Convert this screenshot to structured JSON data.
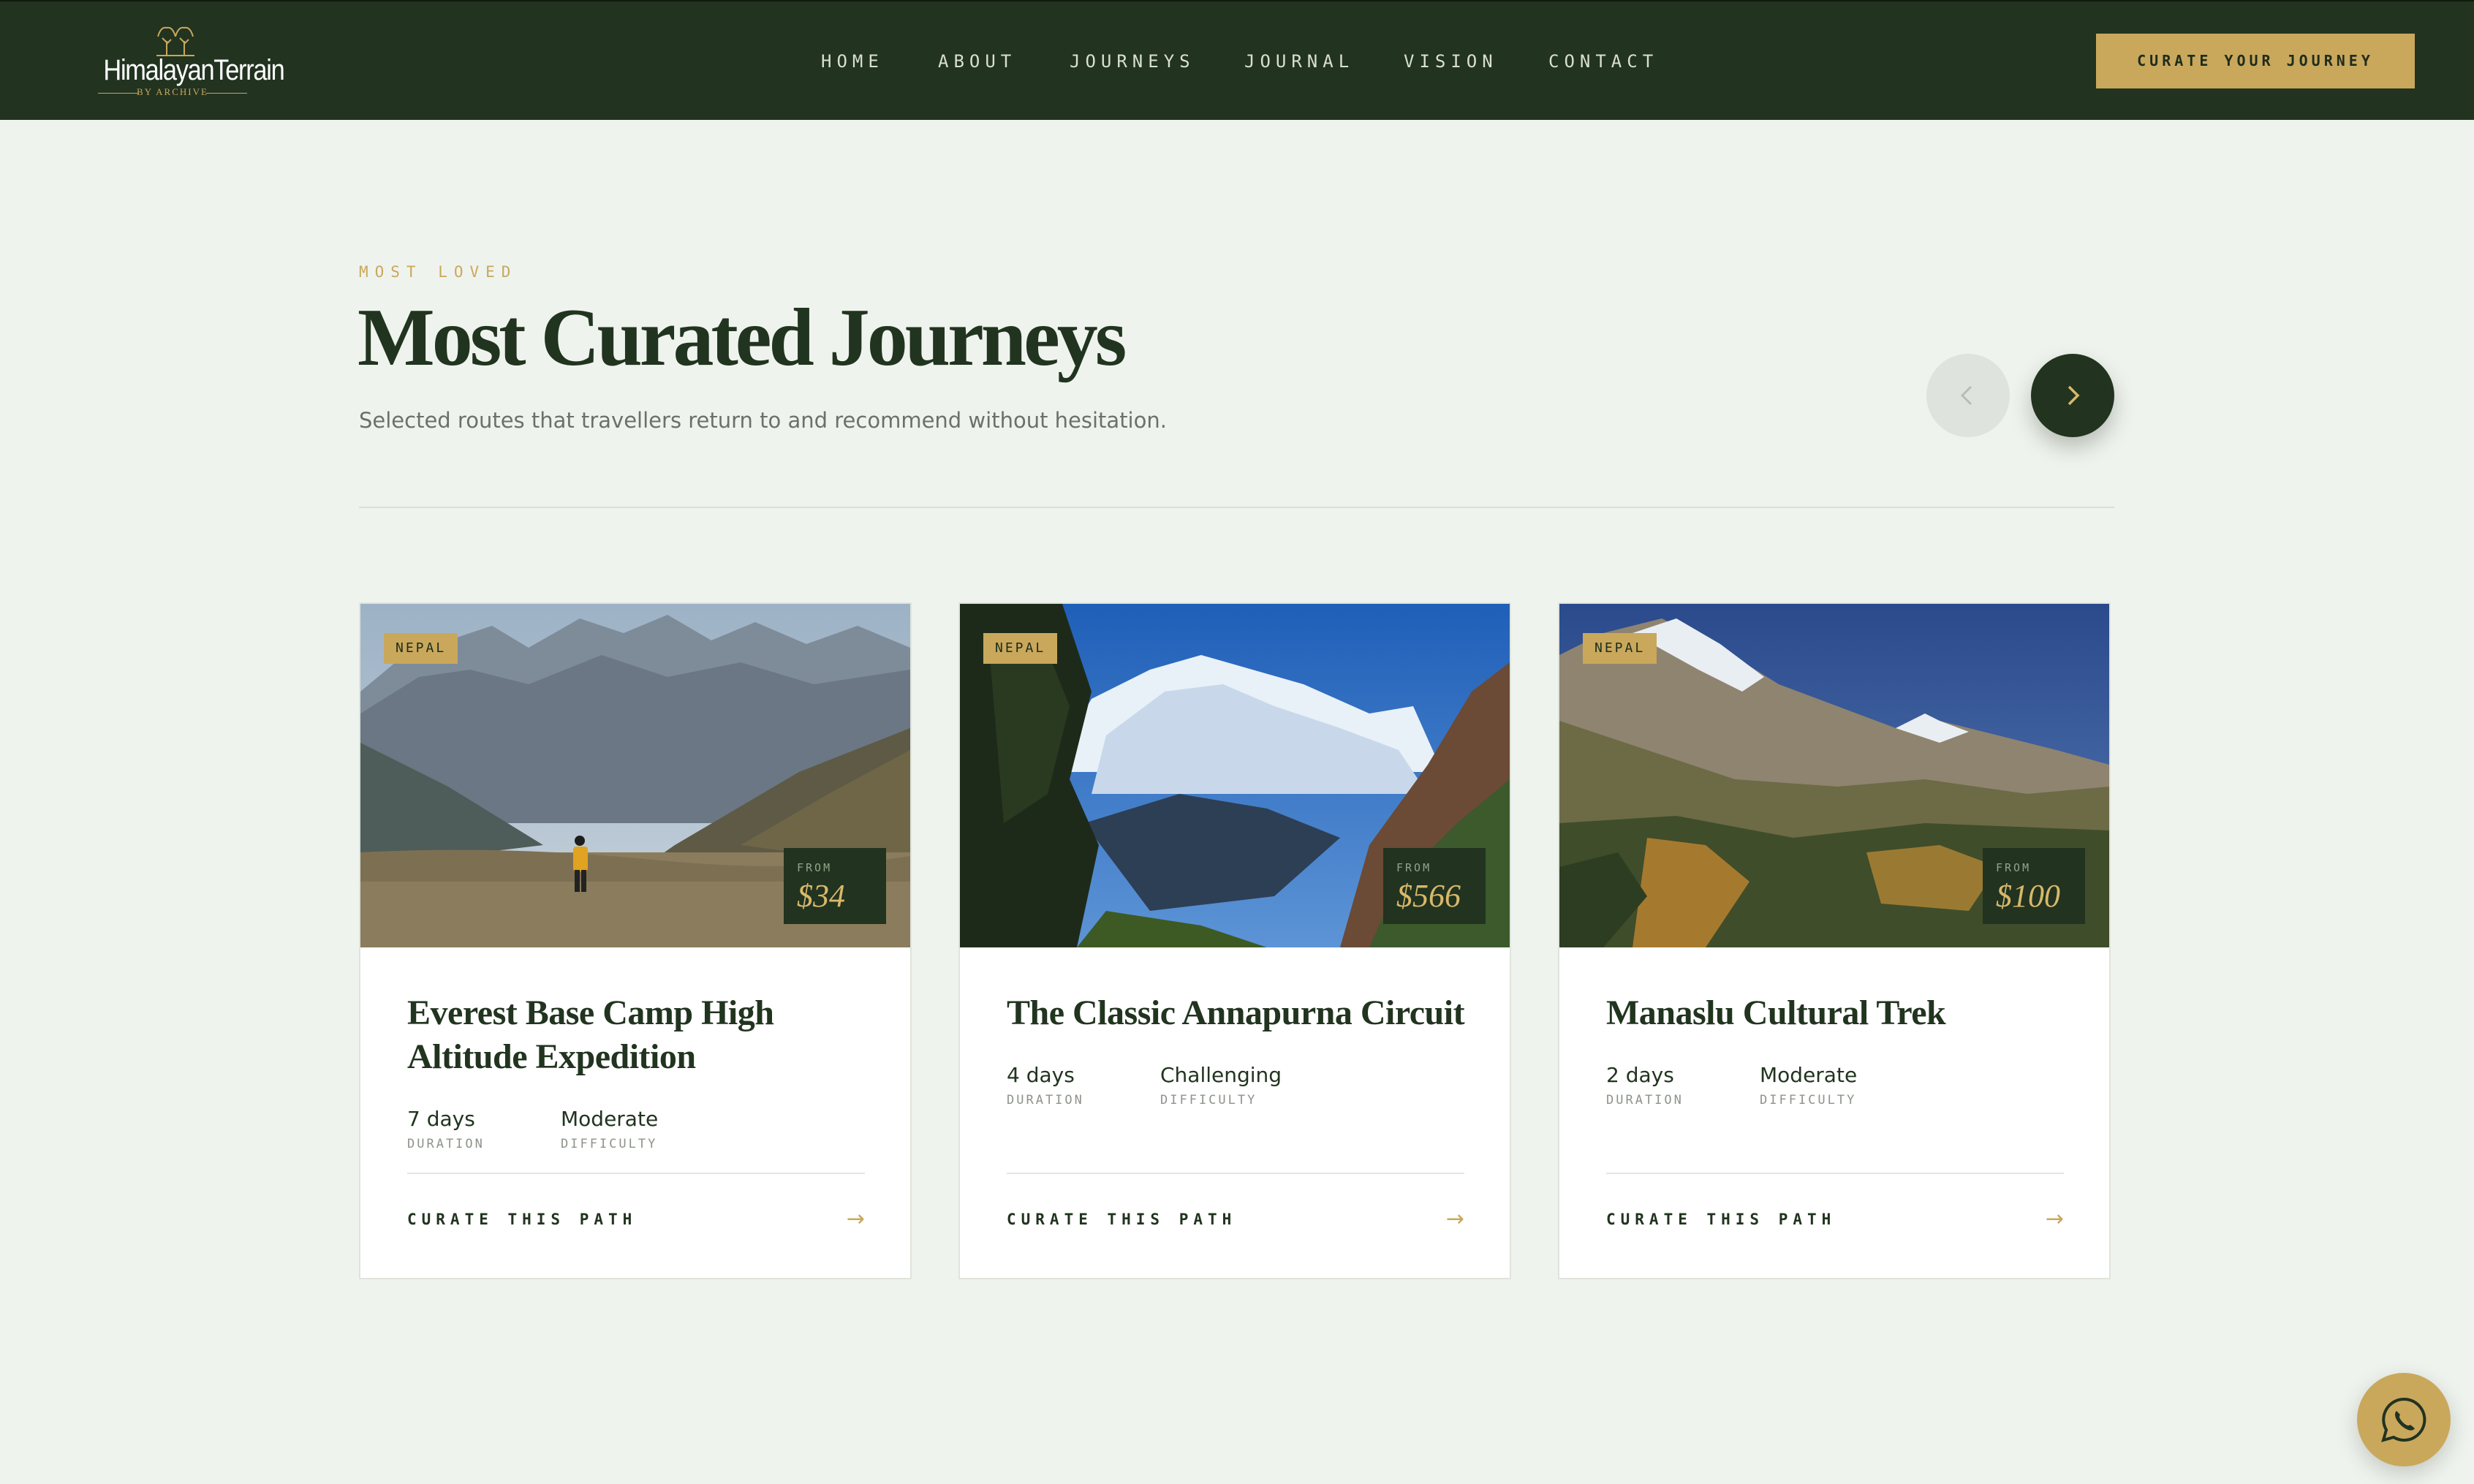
{
  "brand": {
    "name": "HimalayanTerrain",
    "tagline": "BY ARCHIVE"
  },
  "nav": {
    "items": [
      "HOME",
      "ABOUT",
      "JOURNEYS",
      "JOURNAL",
      "VISION",
      "CONTACT"
    ],
    "cta": "CURATE YOUR JOURNEY"
  },
  "section": {
    "eyebrow": "MOST LOVED",
    "title": "Most Curated Journeys",
    "subtitle": "Selected routes that travellers return to and recommend without hesitation."
  },
  "cards": [
    {
      "country": "NEPAL",
      "from_label": "FROM",
      "price": "$34",
      "title": "Everest Base Camp High Altitude Expedition",
      "duration": "7 days",
      "duration_label": "DURATION",
      "difficulty": "Moderate",
      "difficulty_label": "DIFFICULTY",
      "link": "CURATE THIS PATH",
      "arrow": "→"
    },
    {
      "country": "NEPAL",
      "from_label": "FROM",
      "price": "$566",
      "title": "The Classic Annapurna Circuit",
      "duration": "4 days",
      "duration_label": "DURATION",
      "difficulty": "Challenging",
      "difficulty_label": "DIFFICULTY",
      "link": "CURATE THIS PATH",
      "arrow": "→"
    },
    {
      "country": "NEPAL",
      "from_label": "FROM",
      "price": "$100",
      "title": "Manaslu Cultural Trek",
      "duration": "2 days",
      "duration_label": "DURATION",
      "difficulty": "Moderate",
      "difficulty_label": "DIFFICULTY",
      "link": "CURATE THIS PATH",
      "arrow": "→"
    }
  ],
  "colors": {
    "primary": "#223320",
    "accent": "#c9a85c",
    "background": "#eff3ed"
  },
  "icons": {
    "prev": "chevron-left-icon",
    "next": "chevron-right-icon",
    "chat": "whatsapp-icon",
    "logo": "twin-trees-logo"
  }
}
